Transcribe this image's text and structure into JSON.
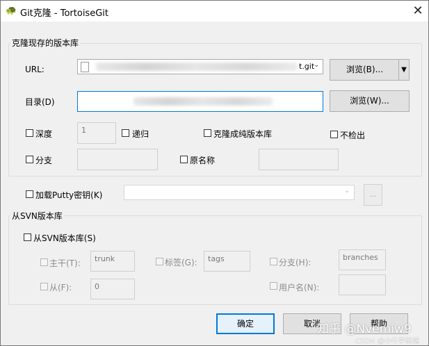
{
  "window": {
    "title": "Git克隆 - TortoiseGit",
    "icon": "tortoisegit-icon"
  },
  "clone_group": {
    "legend": "克隆现存的版本库",
    "url_label": "URL:",
    "url_visible_text": "t.git",
    "browse_url_label": "浏览(B)...",
    "dir_label": "目录(D)",
    "browse_dir_label": "浏览(W)...",
    "depth_label": "深度",
    "depth_value": "1",
    "recursive_label": "递归",
    "bare_label": "克隆成纯版本库",
    "no_checkout_label": "不检出",
    "branch_label": "分支",
    "origin_label": "原名称"
  },
  "putty": {
    "label": "加载Putty密钥(K)",
    "browse_label": "..."
  },
  "svn_group": {
    "legend": "从SVN版本库",
    "from_svn_label": "从SVN版本库(S)",
    "trunk_label": "主干(T):",
    "trunk_value": "trunk",
    "tags_label": "标签(G):",
    "tags_value": "tags",
    "branch_label": "分支(H):",
    "branch_value": "branches",
    "from_label": "从(F):",
    "from_value": "0",
    "username_label": "用户名(N):"
  },
  "footer": {
    "ok_label": "确定",
    "cancel_label": "取消",
    "help_label": "帮助"
  },
  "watermark": {
    "main": "知乎 @Nvemiw9",
    "source": "CSDN @小牛学前端"
  }
}
